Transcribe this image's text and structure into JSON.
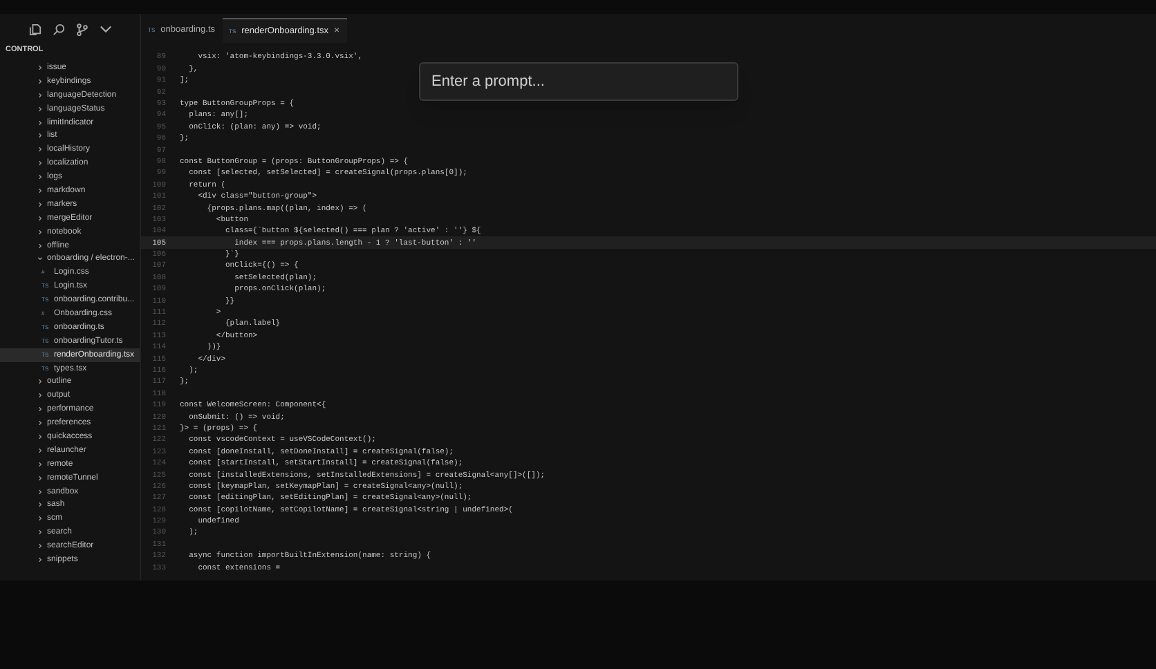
{
  "sidebar": {
    "title": "CONTROL",
    "tree": [
      {
        "label": "issue",
        "expanded": false,
        "selected": false
      },
      {
        "label": "keybindings",
        "expanded": false,
        "selected": false
      },
      {
        "label": "languageDetection",
        "expanded": false,
        "selected": false
      },
      {
        "label": "languageStatus",
        "expanded": false,
        "selected": false
      },
      {
        "label": "limitIndicator",
        "expanded": false,
        "selected": false
      },
      {
        "label": "list",
        "expanded": false,
        "selected": false
      },
      {
        "label": "localHistory",
        "expanded": false,
        "selected": false
      },
      {
        "label": "localization",
        "expanded": false,
        "selected": false
      },
      {
        "label": "logs",
        "expanded": false,
        "selected": false
      },
      {
        "label": "markdown",
        "expanded": false,
        "selected": false
      },
      {
        "label": "markers",
        "expanded": false,
        "selected": false
      },
      {
        "label": "mergeEditor",
        "expanded": false,
        "selected": false
      },
      {
        "label": "notebook",
        "expanded": false,
        "selected": false
      },
      {
        "label": "offline",
        "expanded": false,
        "selected": false
      },
      {
        "label": "onboarding / electron-...",
        "expanded": true,
        "selected": false,
        "children": [
          {
            "label": "Login.css",
            "badge": "#",
            "selected": false
          },
          {
            "label": "Login.tsx",
            "badge": "TS",
            "selected": false
          },
          {
            "label": "onboarding.contribu...",
            "badge": "TS",
            "selected": false
          },
          {
            "label": "Onboarding.css",
            "badge": "#",
            "selected": false
          },
          {
            "label": "onboarding.ts",
            "badge": "TS",
            "selected": false
          },
          {
            "label": "onboardingTutor.ts",
            "badge": "TS",
            "selected": false
          },
          {
            "label": "renderOnboarding.tsx",
            "badge": "TS",
            "selected": true
          },
          {
            "label": "types.tsx",
            "badge": "TS",
            "selected": false
          }
        ]
      },
      {
        "label": "outline",
        "expanded": false,
        "selected": false
      },
      {
        "label": "output",
        "expanded": false,
        "selected": false
      },
      {
        "label": "performance",
        "expanded": false,
        "selected": false
      },
      {
        "label": "preferences",
        "expanded": false,
        "selected": false
      },
      {
        "label": "quickaccess",
        "expanded": false,
        "selected": false
      },
      {
        "label": "relauncher",
        "expanded": false,
        "selected": false
      },
      {
        "label": "remote",
        "expanded": false,
        "selected": false
      },
      {
        "label": "remoteTunnel",
        "expanded": false,
        "selected": false
      },
      {
        "label": "sandbox",
        "expanded": false,
        "selected": false
      },
      {
        "label": "sash",
        "expanded": false,
        "selected": false
      },
      {
        "label": "scm",
        "expanded": false,
        "selected": false
      },
      {
        "label": "search",
        "expanded": false,
        "selected": false
      },
      {
        "label": "searchEditor",
        "expanded": false,
        "selected": false
      },
      {
        "label": "snippets",
        "expanded": false,
        "selected": false
      }
    ]
  },
  "tabs": [
    {
      "badge": "TS",
      "label": "onboarding.ts",
      "selected": false
    },
    {
      "badge": "TS",
      "label": "renderOnboarding.tsx",
      "selected": true,
      "close": "×"
    }
  ],
  "prompt": {
    "placeholder": "Enter a prompt..."
  },
  "editor": {
    "lines": [
      {
        "number": "89",
        "text": "    vsix: 'atom-keybindings-3.3.0.vsix',",
        "current": false
      },
      {
        "number": "90",
        "text": "  },",
        "current": false
      },
      {
        "number": "91",
        "text": "];",
        "current": false
      },
      {
        "number": "92",
        "current": false
      },
      {
        "number": "93",
        "text": "type ButtonGroupProps = {",
        "current": false
      },
      {
        "number": "94",
        "text": "  plans: any[];",
        "current": false
      },
      {
        "number": "95",
        "text": "  onClick: (plan: any) => void;",
        "current": false
      },
      {
        "number": "96",
        "text": "};",
        "current": false
      },
      {
        "number": "97",
        "current": false
      },
      {
        "number": "98",
        "text": "const ButtonGroup = (props: ButtonGroupProps) => {",
        "current": false
      },
      {
        "number": "99",
        "text": "  const [selected, setSelected] = createSignal(props.plans[0]);",
        "current": false
      },
      {
        "number": "100",
        "text": "  return (",
        "current": false
      },
      {
        "number": "101",
        "text": "    <div class=\"button-group\">",
        "current": false
      },
      {
        "number": "102",
        "text": "      {props.plans.map((plan, index) => (",
        "current": false
      },
      {
        "number": "103",
        "text": "        <button",
        "current": false
      },
      {
        "number": "104",
        "text": "          class={`button ${selected() === plan ? 'active' : ''} ${",
        "current": false
      },
      {
        "number": "105",
        "text": "            index === props.plans.length - 1 ? 'last-button' : ''",
        "current": true
      },
      {
        "number": "106",
        "text": "          }`}",
        "current": false
      },
      {
        "number": "107",
        "text": "          onClick={() => {",
        "current": false
      },
      {
        "number": "108",
        "text": "            setSelected(plan);",
        "current": false
      },
      {
        "number": "109",
        "text": "            props.onClick(plan);",
        "current": false
      },
      {
        "number": "110",
        "text": "          }}",
        "current": false
      },
      {
        "number": "111",
        "text": "        >",
        "current": false
      },
      {
        "number": "112",
        "text": "          {plan.label}",
        "current": false
      },
      {
        "number": "113",
        "text": "        </button>",
        "current": false
      },
      {
        "number": "114",
        "text": "      ))}",
        "current": false
      },
      {
        "number": "115",
        "text": "    </div>",
        "current": false
      },
      {
        "number": "116",
        "text": "  );",
        "current": false
      },
      {
        "number": "117",
        "text": "};",
        "current": false
      },
      {
        "number": "118",
        "current": false
      },
      {
        "number": "119",
        "text": "const WelcomeScreen: Component<{",
        "current": false
      },
      {
        "number": "120",
        "text": "  onSubmit: () => void;",
        "current": false
      },
      {
        "number": "121",
        "text": "}> = (props) => {",
        "current": false
      },
      {
        "number": "122",
        "text": "  const vscodeContext = useVSCodeContext();",
        "current": false
      },
      {
        "number": "123",
        "text": "  const [doneInstall, setDoneInstall] = createSignal(false);",
        "current": false
      },
      {
        "number": "124",
        "text": "  const [startInstall, setStartInstall] = createSignal(false);",
        "current": false
      },
      {
        "number": "125",
        "text": "  const [installedExtensions, setInstalledExtensions] = createSignal<any[]>([]);",
        "current": false
      },
      {
        "number": "126",
        "text": "  const [keymapPlan, setKeymapPlan] = createSignal<any>(null);",
        "current": false
      },
      {
        "number": "127",
        "text": "  const [editingPlan, setEditingPlan] = createSignal<any>(null);",
        "current": false
      },
      {
        "number": "128",
        "text": "  const [copilotName, setCopilotName] = createSignal<string | undefined>(",
        "current": false
      },
      {
        "number": "129",
        "text": "    undefined",
        "current": false
      },
      {
        "number": "130",
        "text": "  );",
        "current": false
      },
      {
        "number": "131",
        "current": false
      },
      {
        "number": "132",
        "text": "  async function importBuiltInExtension(name: string) {",
        "current": false
      },
      {
        "number": "133",
        "text": "    const extensions =",
        "current": false
      }
    ]
  }
}
